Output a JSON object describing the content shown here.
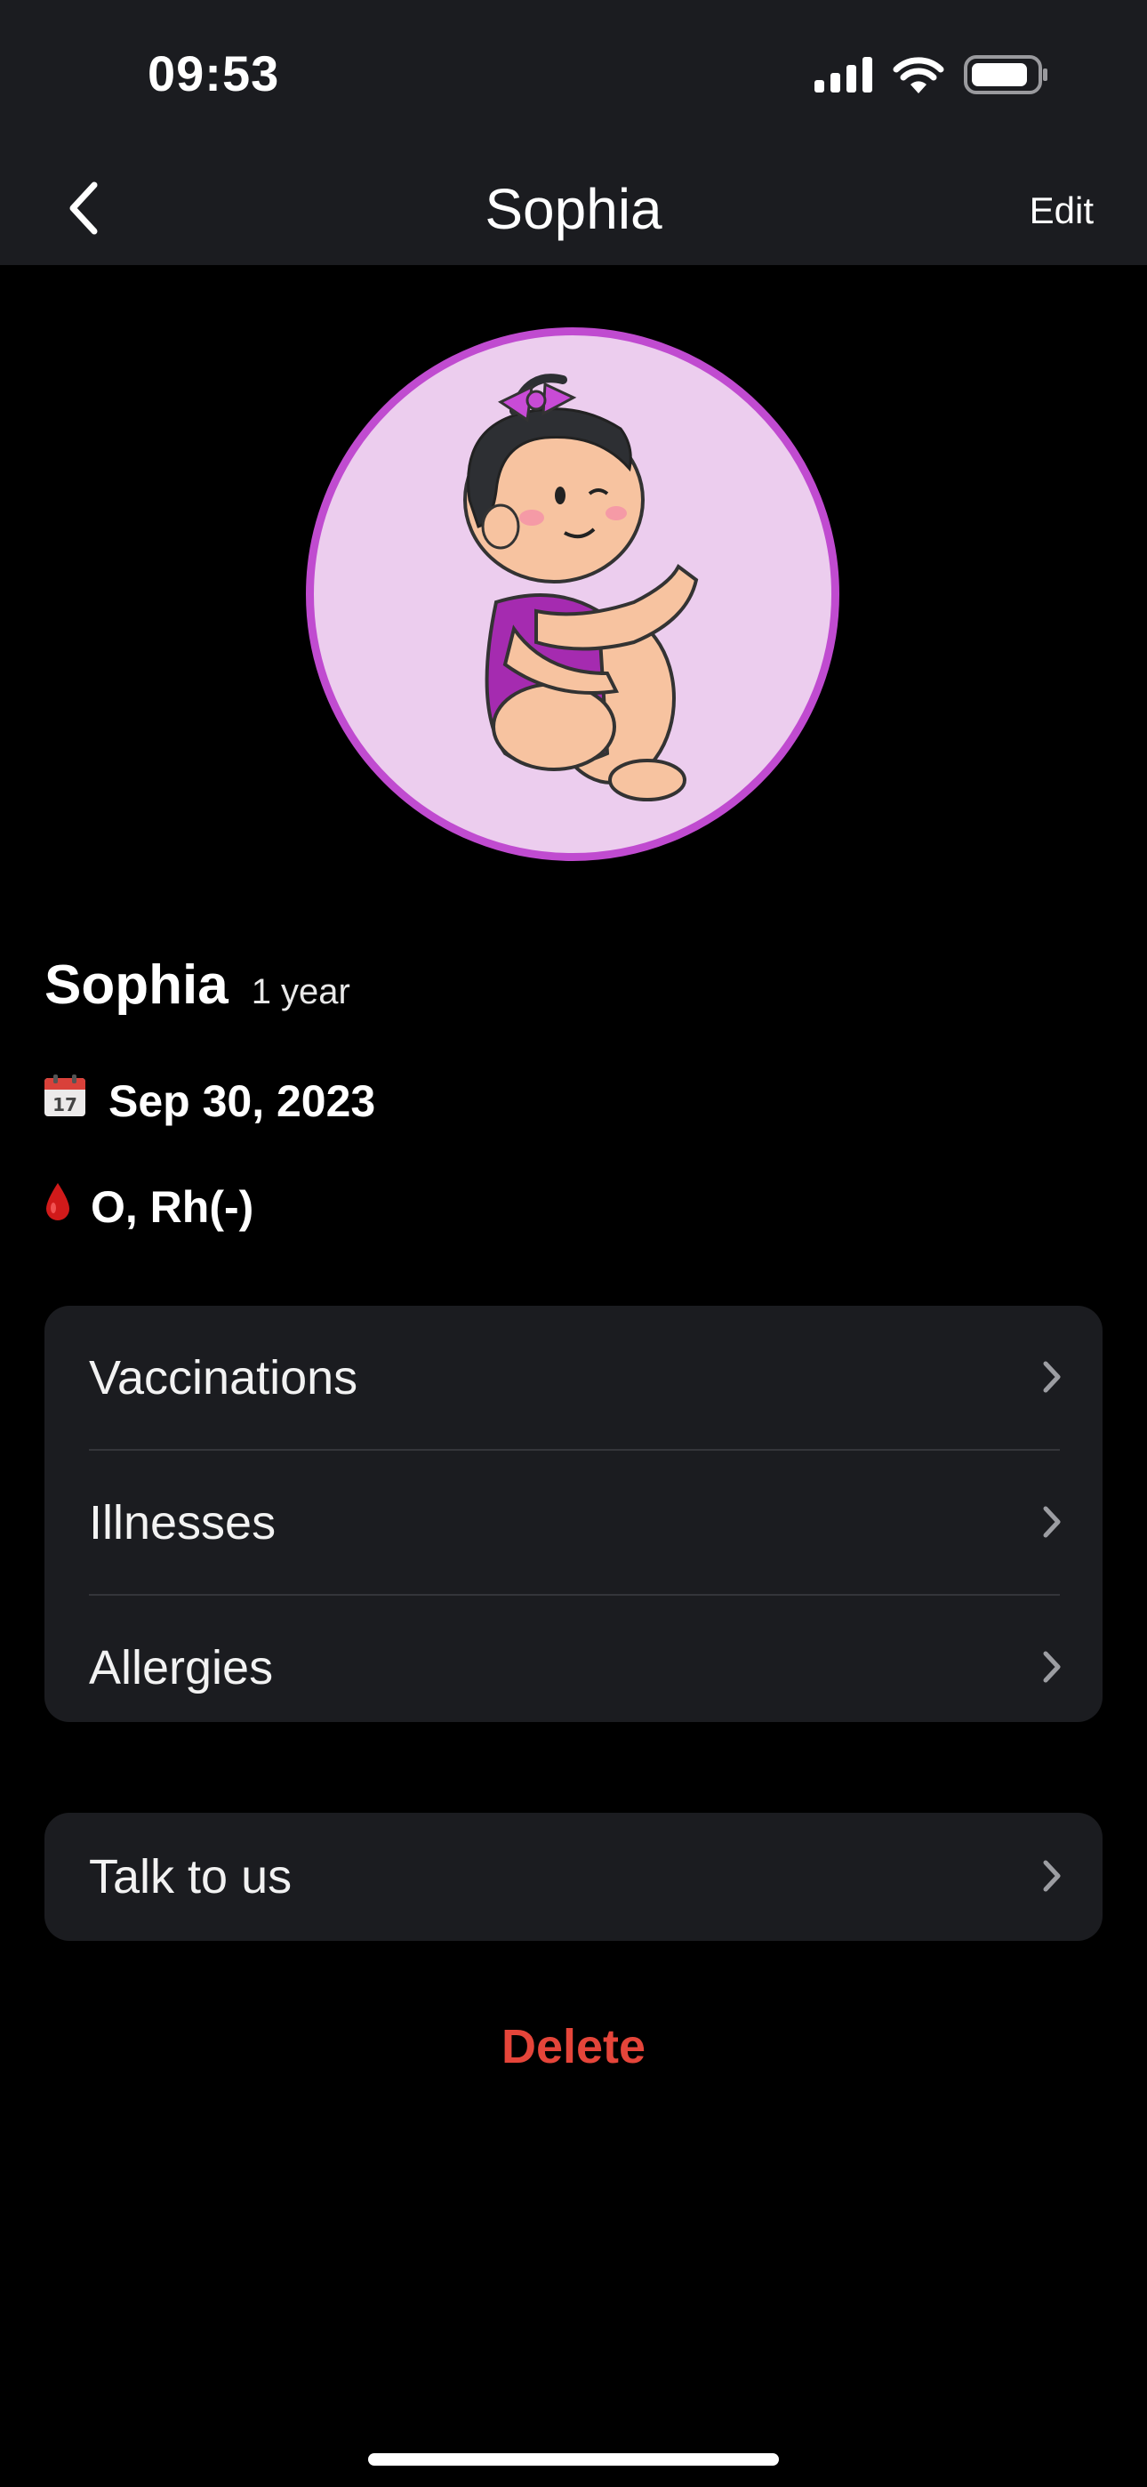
{
  "status_bar": {
    "time": "09:53",
    "icons": [
      "signal-icon",
      "wifi-icon",
      "battery-icon"
    ]
  },
  "nav": {
    "title": "Sophia",
    "edit_label": "Edit",
    "back_icon": "chevron-left-icon"
  },
  "profile": {
    "name": "Sophia",
    "age": "1 year",
    "avatar": "baby-girl-avatar",
    "birth_date": "Sep 30, 2023",
    "birth_date_icon": "calendar-icon",
    "calendar_day": "17",
    "blood_type": "O, Rh(-)",
    "blood_icon": "blood-drop-icon"
  },
  "menu": {
    "items": [
      {
        "label": "Vaccinations"
      },
      {
        "label": "Illnesses"
      },
      {
        "label": "Allergies"
      }
    ]
  },
  "support": {
    "label": "Talk to us"
  },
  "actions": {
    "delete_label": "Delete"
  },
  "colors": {
    "background": "#000000",
    "surface": "#1b1c20",
    "avatar_bg": "#eccdee",
    "avatar_ring": "#c04bd0",
    "danger": "#e5453a"
  }
}
